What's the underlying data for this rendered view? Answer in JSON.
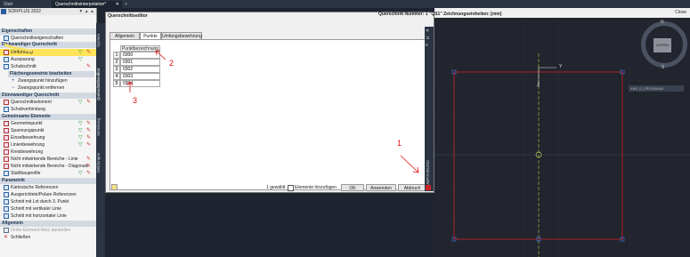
{
  "tabs": [
    {
      "label": "Start"
    },
    {
      "label": "Querschnittsinterpolation*"
    }
  ],
  "app": {
    "title": "SOFiPLUS 2022",
    "controls": "▼ ▲ ▲"
  },
  "left_panel": {
    "sections": {
      "eigenschaften": "Eigenschaften",
      "dickwandig": "Dickwandiger Querschnitt",
      "flaechen": "Flächengeometrie bearbeiten",
      "duennwandig": "Dünnwandiger Querschnitt",
      "gemeinsame": "Gemeinsame Elemente",
      "parametrik": "Parametrik",
      "allgemein": "Allgemein"
    },
    "items": {
      "querschnittseigenschaften": "Querschnittseigenschaften",
      "umfuehrung": "Umführung",
      "aussparung": "Aussparung",
      "schubschnitt": "Schubschnitt",
      "zwangspunkt_add": "Zwangspunkt hinzufügen",
      "zwangspunkt_remove": "Zwangspunkt entfernen",
      "querschnittselement": "Querschnittselement",
      "schubverbindung": "Schubverbindung",
      "geometriepunkt": "Geometriepunkt",
      "spannungspunkt": "Spannungspunkt",
      "einzelbewehrung": "Einzelbewehrung",
      "linienbewehrung": "Linienbewehrung",
      "kreisbewehrung": "Kreisbewehrung",
      "nicht_linie": "Nicht mitwirkende Bereiche - Linie",
      "nicht_diagonale": "Nicht mitwirkende Bereiche - Diagonale",
      "stahlbauprofile": "Stahlbauprofile",
      "kartesische": "Kartesische Referenzen",
      "ausgerichtete": "Ausgerichtete/Polare Referenzen",
      "schnitt_3": "Schnitt mit Lot durch 3. Punkt",
      "schnitt_vertikal": "Schnitt mit vertikaler Linie",
      "schnitt_horizontal": "Schnitt mit horizontaler Linie",
      "finite_netz": "Finite-Element-Netz darstellen",
      "schliessen": "Schließen"
    }
  },
  "vertical_tabs": [
    "System",
    "Querschnittseditor",
    "Verteilung",
    "Meldungen"
  ],
  "dialog": {
    "title": "Querschnittseditor",
    "info": "Querschnitt Nummer: 1 \"QS1\" Zeichnungseinheiten: [mm]",
    "tabs": [
      "Allgemein",
      "Punkte",
      "Umfangsbewehrung"
    ],
    "table": {
      "header": "Punktbezeichnung",
      "rows": [
        {
          "num": "1",
          "value": "0300"
        },
        {
          "num": "2",
          "value": "0301"
        },
        {
          "num": "3",
          "value": "0302"
        },
        {
          "num": "4",
          "value": "0303"
        },
        {
          "num": "5",
          "value": "0304"
        }
      ]
    },
    "selected_count": "1 gewählt",
    "add_elements": "Elemente hinzufügen",
    "buttons": {
      "ok": "OK",
      "apply": "Anwenden",
      "cancel": "Abbruch"
    },
    "side_tab": "UMFÜHRUNG"
  },
  "header": {
    "close": "Close"
  },
  "viewport": {
    "view_cube": "UNTEN",
    "north": "N",
    "south": "S",
    "wcs": "XAS_0_CRCS08444",
    "axis_x": "Y",
    "axis_y": "Z"
  },
  "annotations": [
    "1",
    "2",
    "3"
  ],
  "colors": {
    "highlight": "#ffe45a",
    "rect": "#d01e1e",
    "axis": "#b8c84a"
  }
}
